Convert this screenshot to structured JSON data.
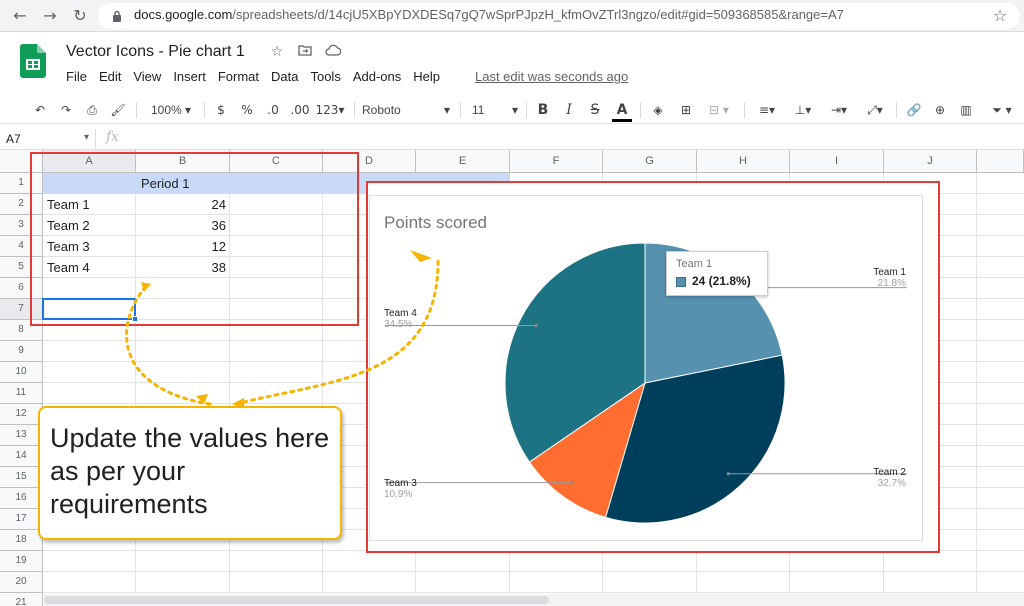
{
  "browser": {
    "url_host": "docs.google.com",
    "url_path": "/spreadsheets/d/14cjU5XBpYDXDESq7gQ7wSprPJpzH_kfmOvZTrl3ngzo/edit#gid=509368585&range=A7",
    "back_icon": "arrow-left-icon",
    "forward_icon": "arrow-right-icon",
    "reload_icon": "reload-icon",
    "lock_icon": "lock-icon",
    "star_icon": "star-icon"
  },
  "doc": {
    "title": "Vector Icons - Pie chart 1",
    "last_edit": "Last edit was seconds ago",
    "menu": [
      "File",
      "Edit",
      "View",
      "Insert",
      "Format",
      "Data",
      "Tools",
      "Add-ons",
      "Help"
    ]
  },
  "toolbar": {
    "zoom": "100%",
    "currency": "$",
    "percent": "%",
    "dec_decrease": ".0",
    "dec_increase": ".00",
    "more_formats": "123",
    "font": "Roboto",
    "font_size": "11",
    "bold": "B",
    "italic": "I",
    "strike": "S",
    "text_color": "A"
  },
  "formula_bar": {
    "name_box": "A7",
    "fx": "fx"
  },
  "grid": {
    "columns": [
      "A",
      "B",
      "C",
      "D",
      "E",
      "F",
      "G",
      "H",
      "I",
      "J"
    ],
    "rows": [
      "1",
      "2",
      "3",
      "4",
      "5",
      "6",
      "7",
      "8",
      "9",
      "10",
      "11",
      "12",
      "13",
      "14",
      "15",
      "16",
      "17",
      "18",
      "19",
      "20",
      "21"
    ],
    "header_cell": "Period 1",
    "data": [
      {
        "team": "Team 1",
        "value": "24"
      },
      {
        "team": "Team 2",
        "value": "36"
      },
      {
        "team": "Team 3",
        "value": "12"
      },
      {
        "team": "Team 4",
        "value": "38"
      }
    ]
  },
  "chart_data": {
    "type": "pie",
    "title": "Points scored",
    "categories": [
      "Team 1",
      "Team 2",
      "Team 3",
      "Team 4"
    ],
    "values": [
      24,
      36,
      12,
      38
    ],
    "percent_labels": [
      "21.8%",
      "32.7%",
      "10.9%",
      "34.5%"
    ],
    "colors": [
      "#5691b0",
      "#003f5c",
      "#ff6e30",
      "#1d7383"
    ],
    "tooltip": {
      "title": "Team 1",
      "value": "24 (21.8%)"
    }
  },
  "callout": {
    "text": "Update the values here as per your requirements"
  }
}
